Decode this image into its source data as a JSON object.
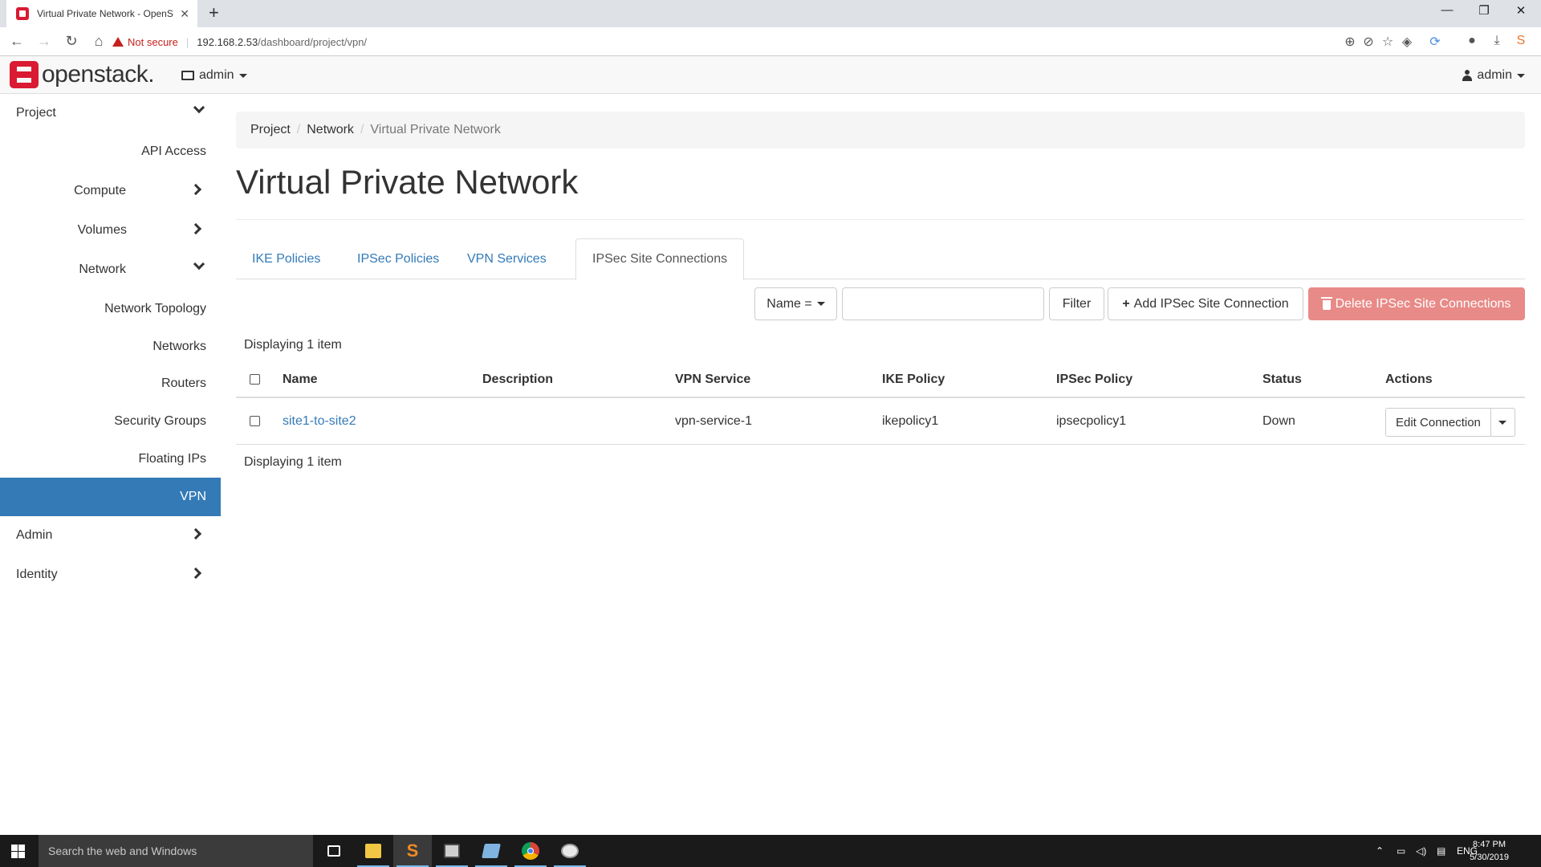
{
  "browser": {
    "tab_title": "Virtual Private Network - OpenSt",
    "security_label": "Not secure",
    "url_host": "192.168.2.53",
    "url_path": "/dashboard/project/vpn/"
  },
  "topbar": {
    "brand": "openstack.",
    "project_menu": "admin",
    "user_menu": "admin"
  },
  "sidebar": {
    "items": [
      {
        "label": "Project"
      },
      {
        "label": "API Access"
      },
      {
        "label": "Compute"
      },
      {
        "label": "Volumes"
      },
      {
        "label": "Network"
      },
      {
        "label": "Network Topology"
      },
      {
        "label": "Networks"
      },
      {
        "label": "Routers"
      },
      {
        "label": "Security Groups"
      },
      {
        "label": "Floating IPs"
      },
      {
        "label": "VPN"
      },
      {
        "label": "Admin"
      },
      {
        "label": "Identity"
      }
    ]
  },
  "breadcrumb": [
    "Project",
    "Network",
    "Virtual Private Network"
  ],
  "page_title": "Virtual Private Network",
  "tabs": [
    "IKE Policies",
    "IPSec Policies",
    "VPN Services",
    "IPSec Site Connections"
  ],
  "toolbar": {
    "filter_field": "Name =",
    "filter_value": "",
    "filter_button": "Filter",
    "add_button": "Add IPSec Site Connection",
    "delete_button": "Delete IPSec Site Connections"
  },
  "table": {
    "count_text": "Displaying 1 item",
    "columns": [
      "Name",
      "Description",
      "VPN Service",
      "IKE Policy",
      "IPSec Policy",
      "Status",
      "Actions"
    ],
    "rows": [
      {
        "name": "site1-to-site2",
        "description": "",
        "vpn_service": "vpn-service-1",
        "ike_policy": "ikepolicy1",
        "ipsec_policy": "ipsecpolicy1",
        "status": "Down",
        "action": "Edit Connection"
      }
    ]
  },
  "taskbar": {
    "search_placeholder": "Search the web and Windows",
    "language": "ENG",
    "time": "8:47 PM",
    "date": "5/30/2019"
  },
  "colors": {
    "accent": "#337ab7",
    "brand": "#da1a32",
    "danger": "#e88a87"
  }
}
